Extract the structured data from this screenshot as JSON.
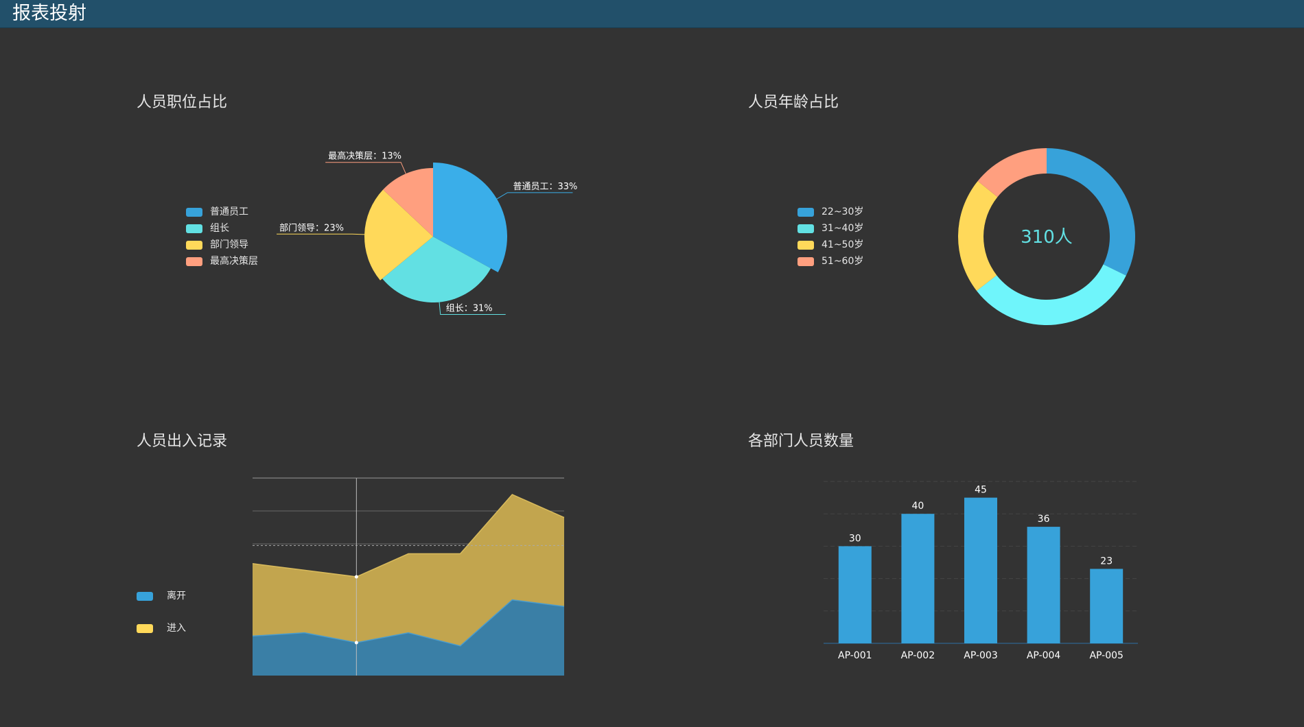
{
  "header": {
    "title": "报表投射"
  },
  "colors": {
    "topbar": "#22506a",
    "background": "#333333",
    "blue": "#3aaee9",
    "cyan": "#62e0e3",
    "yellow": "#ffd95a",
    "salmon": "#ff9f7f"
  },
  "position_pie": {
    "title": "人员职位占比",
    "legend": [
      {
        "label": "普通员工",
        "color": "#37a2da"
      },
      {
        "label": "组长",
        "color": "#62e0e3"
      },
      {
        "label": "部门领导",
        "color": "#ffd95a"
      },
      {
        "label": "最高决策层",
        "color": "#ff9f7f"
      }
    ]
  },
  "age_donut": {
    "title": "人员年龄占比",
    "center_label": "310人",
    "legend": [
      {
        "label": "22~30岁",
        "color": "#37a2da"
      },
      {
        "label": "31~40岁",
        "color": "#62e0e3"
      },
      {
        "label": "41~50岁",
        "color": "#ffd95a"
      },
      {
        "label": "51~60岁",
        "color": "#ff9f7f"
      }
    ]
  },
  "inout_area": {
    "title": "人员出入记录",
    "legend": [
      {
        "label": "离开",
        "color": "#37a2da"
      },
      {
        "label": "进入",
        "color": "#ffd95a"
      }
    ]
  },
  "dept_bar": {
    "title": "各部门人员数量"
  },
  "chart_data": [
    {
      "type": "pie",
      "title": "人员职位占比",
      "labels": [
        "普通员工",
        "组长",
        "部门领导",
        "最高决策层"
      ],
      "values": [
        33,
        31,
        23,
        13
      ],
      "unit": "%",
      "data_labels": [
        "普通员工：33%",
        "组长：31%",
        "部门领导：23%",
        "最高决策层：13%"
      ],
      "colors": [
        "#3aaee9",
        "#62e0e3",
        "#ffd95a",
        "#ff9f7f"
      ],
      "legend_position": "left"
    },
    {
      "type": "pie",
      "subtype": "donut",
      "title": "人员年龄占比",
      "center_text": "310人",
      "labels": [
        "22~30岁",
        "31~40岁",
        "41~50岁",
        "51~60岁"
      ],
      "values": [
        100,
        100,
        66,
        44
      ],
      "colors": [
        "#37a2da",
        "#6ff5fb",
        "#ffd95a",
        "#ff9f7f"
      ],
      "legend_position": "left"
    },
    {
      "type": "area",
      "title": "人员出入记录",
      "stacked": true,
      "x": [
        1,
        2,
        3,
        4,
        5,
        6,
        7
      ],
      "ylim": [
        0,
        6
      ],
      "series": [
        {
          "name": "离开",
          "values": [
            1.2,
            1.3,
            1.0,
            1.3,
            0.9,
            2.3,
            2.1
          ],
          "color": "#37a2da"
        },
        {
          "name": "进入",
          "values": [
            2.2,
            1.9,
            2.0,
            2.4,
            2.8,
            3.2,
            2.7
          ],
          "color": "#ffd95a"
        }
      ],
      "grid": true,
      "legend_position": "left"
    },
    {
      "type": "bar",
      "title": "各部门人员数量",
      "categories": [
        "AP-001",
        "AP-002",
        "AP-003",
        "AP-004",
        "AP-005"
      ],
      "values": [
        30,
        40,
        45,
        36,
        23
      ],
      "ylim": [
        0,
        50
      ],
      "color": "#37a2da",
      "grid": true
    }
  ]
}
